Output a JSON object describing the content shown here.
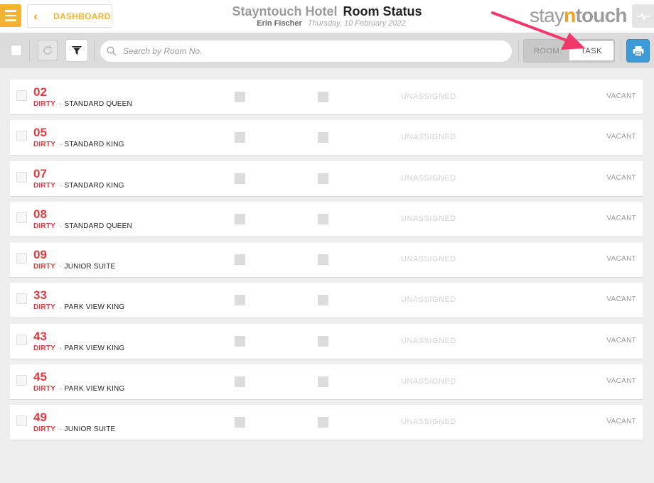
{
  "header": {
    "dashboard_label": "DASHBOARD",
    "hotel_name": "Stayntouch Hotel",
    "page_title": "Room Status",
    "user_name": "Erin Fischer",
    "date": "Thursday, 10 February 2022",
    "logo": {
      "part1": "stay",
      "part2": "n",
      "part3": "touch"
    }
  },
  "toolbar": {
    "search_placeholder": "Search by Room No.",
    "toggle_room": "ROOM",
    "toggle_task": "TASK",
    "active_toggle": "TASK"
  },
  "colors": {
    "accent": "#f3b331",
    "dirty": "#e0393e",
    "print_button": "#3d9ad9",
    "annotation_arrow": "#f0386b"
  },
  "icons": [
    "menu-icon",
    "double-chevron-left-icon",
    "activity-icon",
    "refresh-icon",
    "filter-icon",
    "search-icon",
    "print-icon"
  ],
  "rooms": [
    {
      "number": "02",
      "status": "DIRTY",
      "type": "STANDARD QUEEN",
      "assignment": "UNASSIGNED",
      "occupancy": "VACANT"
    },
    {
      "number": "05",
      "status": "DIRTY",
      "type": "STANDARD KING",
      "assignment": "UNASSIGNED",
      "occupancy": "VACANT"
    },
    {
      "number": "07",
      "status": "DIRTY",
      "type": "STANDARD KING",
      "assignment": "UNASSIGNED",
      "occupancy": "VACANT"
    },
    {
      "number": "08",
      "status": "DIRTY",
      "type": "STANDARD QUEEN",
      "assignment": "UNASSIGNED",
      "occupancy": "VACANT"
    },
    {
      "number": "09",
      "status": "DIRTY",
      "type": "JUNIOR SUITE",
      "assignment": "UNASSIGNED",
      "occupancy": "VACANT"
    },
    {
      "number": "33",
      "status": "DIRTY",
      "type": "PARK VIEW KING",
      "assignment": "UNASSIGNED",
      "occupancy": "VACANT"
    },
    {
      "number": "43",
      "status": "DIRTY",
      "type": "PARK VIEW KING",
      "assignment": "UNASSIGNED",
      "occupancy": "VACANT"
    },
    {
      "number": "45",
      "status": "DIRTY",
      "type": "PARK VIEW KING",
      "assignment": "UNASSIGNED",
      "occupancy": "VACANT"
    },
    {
      "number": "49",
      "status": "DIRTY",
      "type": "JUNIOR SUITE",
      "assignment": "UNASSIGNED",
      "occupancy": "VACANT"
    }
  ]
}
